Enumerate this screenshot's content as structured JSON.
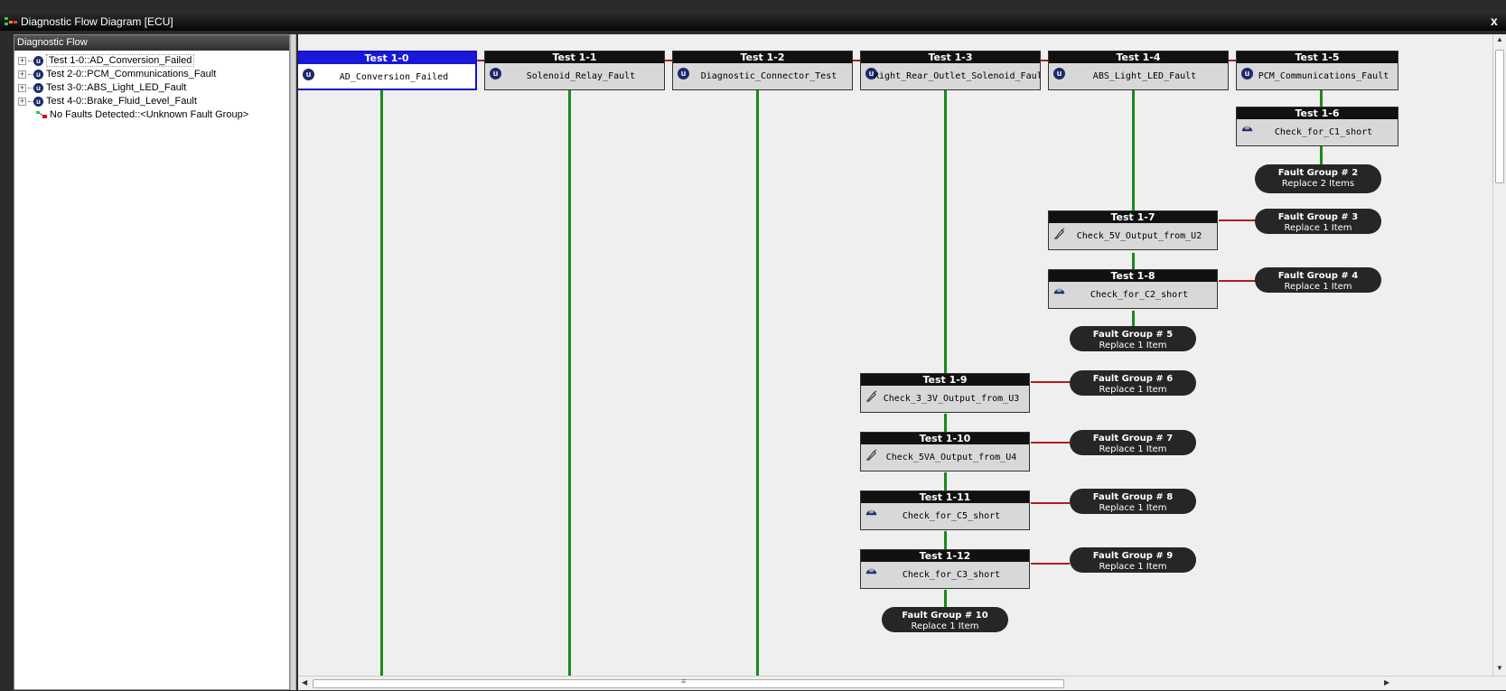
{
  "window": {
    "title": "Diagnostic Flow Diagram [ECU]",
    "close_label": "x"
  },
  "left_pane": {
    "header": "Diagnostic Flow",
    "tree": [
      {
        "label": "Test 1-0::AD_Conversion_Failed"
      },
      {
        "label": "Test 2-0::PCM_Communications_Fault"
      },
      {
        "label": "Test 3-0::ABS_Light_LED_Fault"
      },
      {
        "label": "Test 4-0::Brake_Fluid_Level_Fault"
      },
      {
        "label": "No Faults Detected::<Unknown Fault Group>"
      }
    ]
  },
  "nodes": {
    "n0": {
      "title": "Test 1-0",
      "label": "AD_Conversion_Failed",
      "icon": "u-icon"
    },
    "n1": {
      "title": "Test 1-1",
      "label": "Solenoid_Relay_Fault",
      "icon": "u-icon"
    },
    "n2": {
      "title": "Test 1-2",
      "label": "Diagnostic_Connector_Test",
      "icon": "u-icon"
    },
    "n3": {
      "title": "Test 1-3",
      "label": "Right_Rear_Outlet_Solenoid_Fault",
      "icon": "u-icon"
    },
    "n4": {
      "title": "Test 1-4",
      "label": "ABS_Light_LED_Fault",
      "icon": "u-icon"
    },
    "n5": {
      "title": "Test 1-5",
      "label": "PCM_Communications_Fault",
      "icon": "u-icon"
    },
    "n6": {
      "title": "Test 1-6",
      "label": "Check_for_C1_short",
      "icon": "eye-icon"
    },
    "n7": {
      "title": "Test 1-7",
      "label": "Check_5V_Output_from_U2",
      "icon": "probe-icon"
    },
    "n8": {
      "title": "Test 1-8",
      "label": "Check_for_C2_short",
      "icon": "eye-icon"
    },
    "n9": {
      "title": "Test 1-9",
      "label": "Check_3_3V_Output_from_U3",
      "icon": "probe-icon"
    },
    "n10": {
      "title": "Test 1-10",
      "label": "Check_5VA_Output_from_U4",
      "icon": "probe-icon"
    },
    "n11": {
      "title": "Test 1-11",
      "label": "Check_for_C5_short",
      "icon": "eye-icon"
    },
    "n12": {
      "title": "Test 1-12",
      "label": "Check_for_C3_short",
      "icon": "eye-icon"
    }
  },
  "faults": {
    "f2": {
      "group": "Fault Group # 2",
      "action": "Replace 2 Items"
    },
    "f3": {
      "group": "Fault Group # 3",
      "action": "Replace 1 Item"
    },
    "f4": {
      "group": "Fault Group # 4",
      "action": "Replace 1 Item"
    },
    "f5": {
      "group": "Fault Group # 5",
      "action": "Replace 1 Item"
    },
    "f6": {
      "group": "Fault Group # 6",
      "action": "Replace 1 Item"
    },
    "f7": {
      "group": "Fault Group # 7",
      "action": "Replace 1 Item"
    },
    "f8": {
      "group": "Fault Group # 8",
      "action": "Replace 1 Item"
    },
    "f9": {
      "group": "Fault Group # 9",
      "action": "Replace 1 Item"
    },
    "f10": {
      "group": "Fault Group # 10",
      "action": "Replace 1 Item"
    }
  },
  "colors": {
    "pass_line": "#1a8a1a",
    "fail_line": "#b01c1c",
    "selected": "#1818d8"
  }
}
